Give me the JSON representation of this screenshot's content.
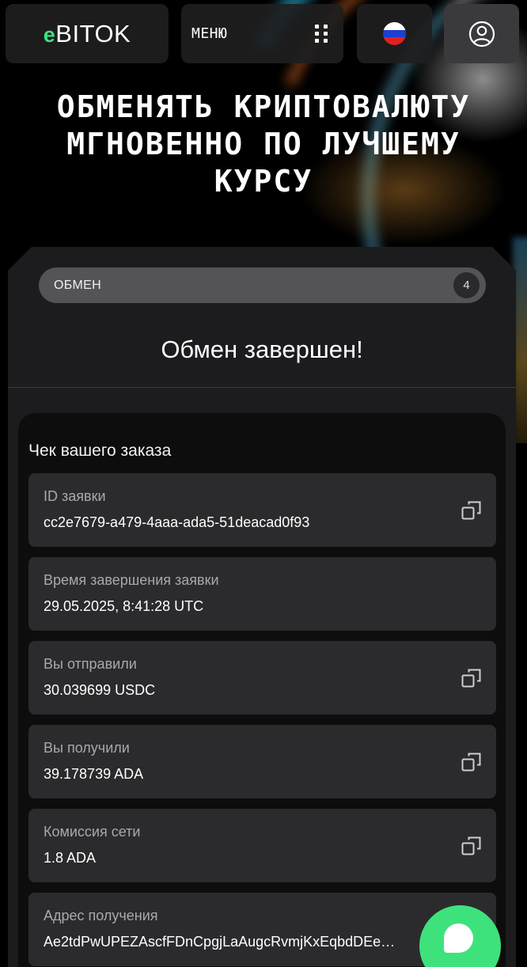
{
  "header": {
    "logo_prefix": "e",
    "logo_text": "BITOK",
    "menu_label": "МЕНЮ",
    "colors": {
      "brand_green": "#3ee27c",
      "card_bg": "#1e1e20"
    }
  },
  "hero": {
    "title": "ОБМЕНЯТЬ КРИПТОВАЛЮТУ МГНОВЕННО ПО ЛУЧШЕМУ КУРСУ"
  },
  "exchange": {
    "tab_label": "ОБМЕН",
    "step": "4",
    "status_title": "Обмен завершен!"
  },
  "receipt": {
    "title": "Чек вашего заказа",
    "rows": [
      {
        "label": "ID заявки",
        "value": "cc2e7679-a479-4aaa-ada5-51deacad0f93",
        "copyable": true
      },
      {
        "label": "Время завершения заявки",
        "value": "29.05.2025, 8:41:28 UTC",
        "copyable": false
      },
      {
        "label": "Вы отправили",
        "value": "30.039699 USDC",
        "copyable": true
      },
      {
        "label": "Вы получили",
        "value": "39.178739 ADA",
        "copyable": true
      },
      {
        "label": "Комиссия сети",
        "value": "1.8 ADA",
        "copyable": true
      },
      {
        "label": "Адрес получения",
        "value": "Ae2tdPwUPEZAscfFDnCpgjLaAugcRvmjKxEqbdDEe…",
        "copyable": false
      }
    ]
  },
  "icons": {
    "menu": "grid-dots-icon",
    "language": "russia-flag-icon",
    "profile": "user-circle-icon",
    "copy": "copy-icon",
    "chat": "chat-bubble-icon"
  }
}
